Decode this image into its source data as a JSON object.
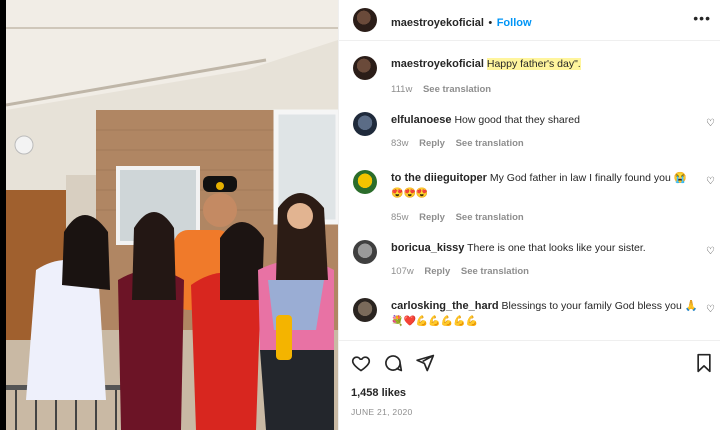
{
  "post": {
    "username": "maestroyekoficial",
    "separator": "•",
    "follow_label": "Follow",
    "more_label": "•••"
  },
  "caption": {
    "username": "maestroyekoficial",
    "text": "Happy father's day\".",
    "time": "111w",
    "see_translation": "See translation"
  },
  "comments": [
    {
      "username": "elfulanoese",
      "text": "How good that they shared",
      "time": "83w",
      "reply": "Reply",
      "see_translation": "See translation"
    },
    {
      "username": "to the diieguitoper",
      "text": "My God father in law I finally found you 😭",
      "emoji_line": "😍😍😍",
      "time": "85w",
      "reply": "Reply",
      "see_translation": "See translation"
    },
    {
      "username": "boricua_kissy",
      "text": "There is one that looks like your sister.",
      "time": "107w",
      "reply": "Reply",
      "see_translation": "See translation"
    },
    {
      "username": "carlosking_the_hard",
      "text": "Blessings to your family God bless you 🙏",
      "emoji_line": "💐❤️💪💪💪💪💪"
    }
  ],
  "actions": {
    "likes": "1,458 likes",
    "date": "JUNE 21, 2020"
  },
  "icons": [
    "heart-icon",
    "comment-icon",
    "share-icon",
    "bookmark-icon"
  ]
}
